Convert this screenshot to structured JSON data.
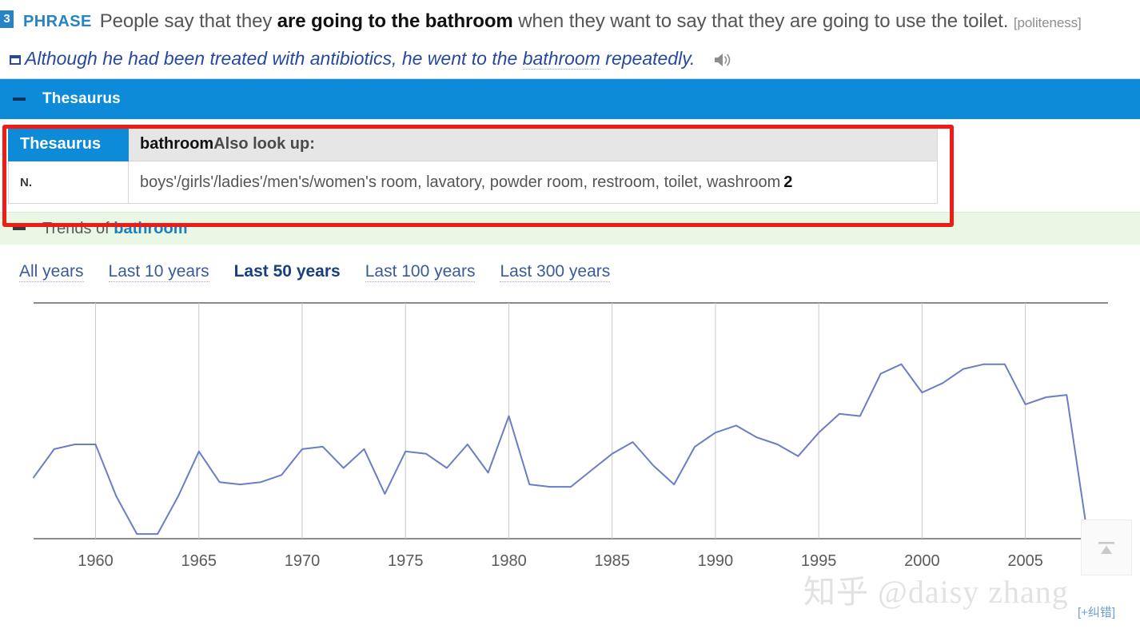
{
  "sense": {
    "number": "3",
    "pos_tag": "PHRASE",
    "text_before": "People say that they ",
    "text_bold": "are going to the bathroom",
    "text_after": " when they want to say that they are going to use the toilet.",
    "register": "[politeness]"
  },
  "example": {
    "text_before": "Although he had been treated with antibiotics, he went to the ",
    "keyword": "bathroom",
    "text_after": " repeatedly.",
    "audio_icon": "speaker-icon"
  },
  "thesaurus_section": {
    "bar_title": "Thesaurus",
    "collapse_icon": "minus-icon",
    "bar_color": "#0d8bd9",
    "highlight_color": "#ee1c17",
    "table": {
      "label": "Thesaurus",
      "headword": "bathroom",
      "also_look_up": "Also look up:",
      "rows": [
        {
          "pos": "N.",
          "synonyms": "boys'/girls'/ladies'/men's/women's room, lavatory, powder room, restroom, toilet, washroom",
          "count": "2"
        }
      ]
    }
  },
  "trends_section": {
    "collapse_icon": "minus-icon",
    "title_prefix": "Trends of ",
    "title_keyword": "bathroom",
    "bar_color": "#eaf7e4",
    "ranges": [
      {
        "label": "All years",
        "active": false
      },
      {
        "label": "Last 10 years",
        "active": false
      },
      {
        "label": "Last 50 years",
        "active": true
      },
      {
        "label": "Last 100 years",
        "active": false
      },
      {
        "label": "Last 300 years",
        "active": false
      }
    ]
  },
  "chart_data": {
    "type": "line",
    "title": "Trends of bathroom",
    "xlabel": "",
    "ylabel": "",
    "grid": true,
    "legend": false,
    "line_color": "#6b7dc4",
    "xlim": [
      1957,
      2009
    ],
    "ylim": [
      0,
      100
    ],
    "tick_labels": [
      "1960",
      "1965",
      "1970",
      "1975",
      "1980",
      "1985",
      "1990",
      "1995",
      "2000",
      "2005"
    ],
    "ticks": [
      1960,
      1965,
      1970,
      1975,
      1980,
      1985,
      1990,
      1995,
      2000,
      2005
    ],
    "x": [
      1957,
      1958,
      1959,
      1960,
      1961,
      1962,
      1963,
      1964,
      1965,
      1966,
      1967,
      1968,
      1969,
      1970,
      1971,
      1972,
      1973,
      1974,
      1975,
      1976,
      1977,
      1978,
      1979,
      1980,
      1981,
      1982,
      1983,
      1984,
      1985,
      1986,
      1987,
      1988,
      1989,
      1990,
      1991,
      1992,
      1993,
      1994,
      1995,
      1996,
      1997,
      1998,
      1999,
      2000,
      2001,
      2002,
      2003,
      2004,
      2005,
      2006,
      2007,
      2008
    ],
    "values": [
      26,
      38,
      40,
      40,
      18,
      2,
      2,
      18,
      37,
      24,
      23,
      24,
      27,
      38,
      39,
      30,
      38,
      19,
      37,
      36,
      30,
      40,
      28,
      52,
      23,
      22,
      22,
      29,
      36,
      41,
      31,
      23,
      39,
      45,
      48,
      43,
      40,
      35,
      45,
      53,
      52,
      70,
      74,
      62,
      66,
      72,
      74,
      74,
      57,
      60,
      61,
      2
    ]
  },
  "watermark": "知乎 @daisy zhang",
  "report_link": "[+纠错]",
  "scroll_top_icon": "arrow-up-icon"
}
